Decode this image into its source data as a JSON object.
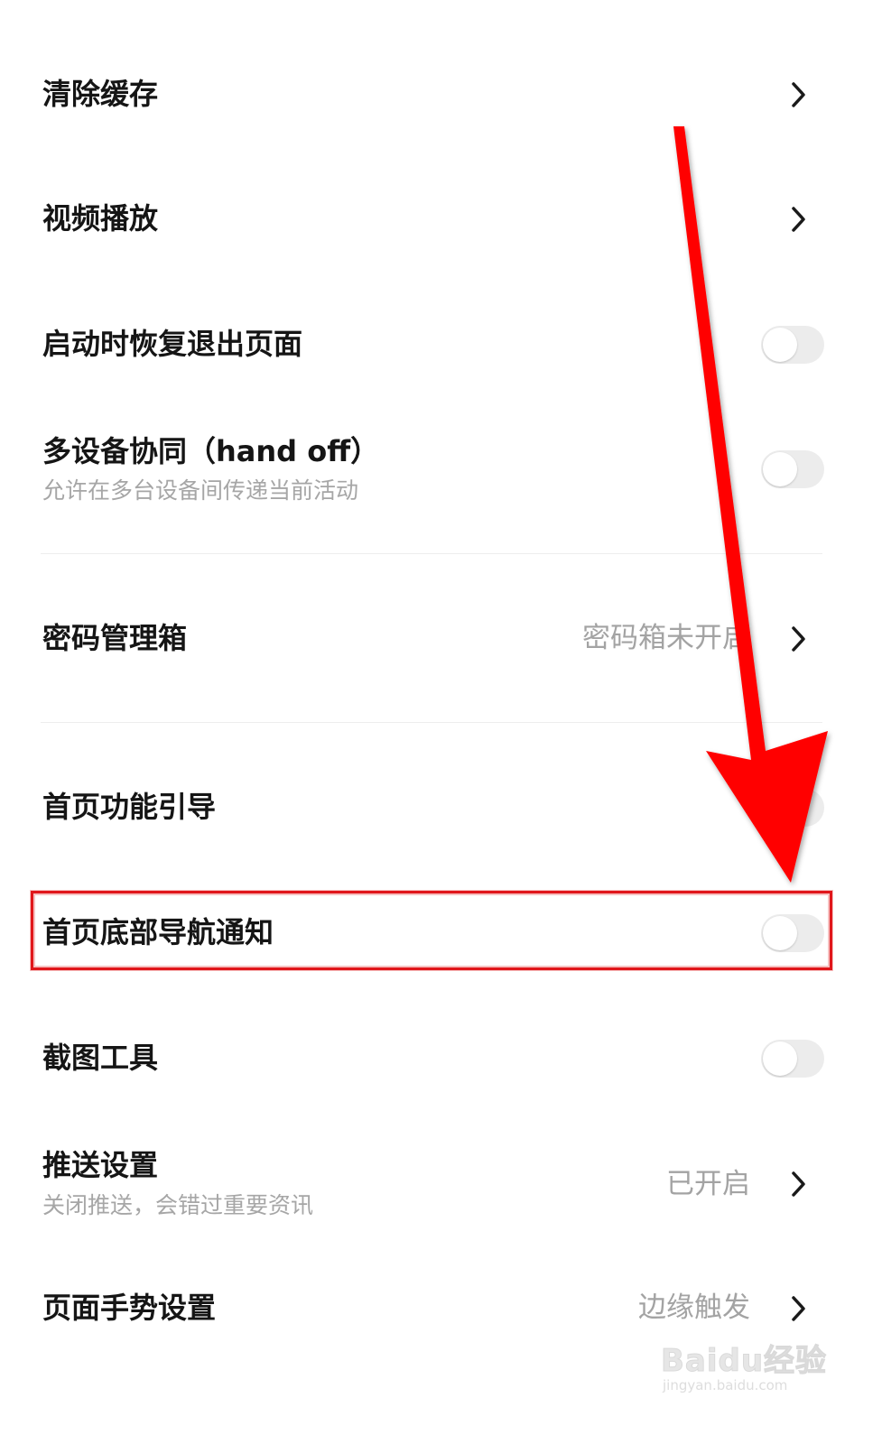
{
  "settings": {
    "items": [
      {
        "title": "清除缓存",
        "control": "chevron"
      },
      {
        "title": "视频播放",
        "control": "chevron"
      },
      {
        "title": "启动时恢复退出页面",
        "control": "toggle",
        "on": false
      },
      {
        "title": "多设备协同（hand off）",
        "subtitle": "允许在多台设备间传递当前活动",
        "control": "toggle",
        "on": false
      },
      {
        "title": "密码管理箱",
        "value": "密码箱未开启",
        "control": "chevron"
      },
      {
        "title": "首页功能引导",
        "control": "toggle",
        "on": false
      },
      {
        "title": "首页底部导航通知",
        "control": "toggle",
        "on": false,
        "highlighted": true
      },
      {
        "title": "截图工具",
        "control": "toggle",
        "on": false
      },
      {
        "title": "推送设置",
        "subtitle": "关闭推送，会错过重要资讯",
        "value": "已开启",
        "control": "chevron"
      },
      {
        "title": "页面手势设置",
        "value": "边缘触发",
        "control": "chevron"
      }
    ]
  },
  "annotation": {
    "arrow_color": "#ff0000",
    "highlight_color": "#e0161a"
  },
  "watermark": {
    "main": "Baidu经验",
    "sub": "jingyan.baidu.com"
  },
  "icons": {
    "chevron": "chevron-right-icon",
    "toggle": "toggle-switch"
  }
}
